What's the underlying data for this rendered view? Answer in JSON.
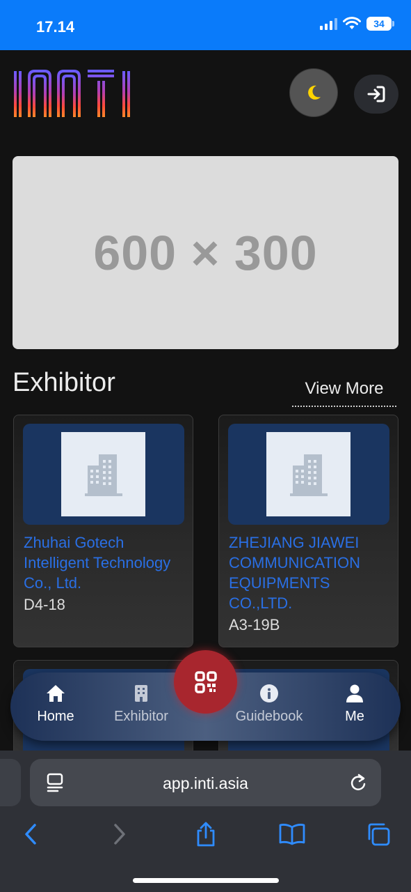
{
  "status_bar": {
    "time": "17.14",
    "battery": "34"
  },
  "header": {
    "logo_text": "INTI",
    "theme_icon": "moon-icon",
    "login_icon": "login-icon"
  },
  "banner": {
    "placeholder_text": "600 × 300"
  },
  "exhibitor_section": {
    "title": "Exhibitor",
    "view_more": "View More",
    "cards": [
      {
        "name": "Zhuhai Gotech Intelligent Technology Co., Ltd.",
        "booth": "D4-18",
        "icon": "building-icon"
      },
      {
        "name": "ZHEJIANG JIAWEI COMMUNICATION EQUIPMENTS CO.,LTD.",
        "booth": "A3-19B",
        "icon": "building-icon"
      }
    ]
  },
  "bottom_nav": {
    "items": [
      {
        "label": "Home",
        "icon": "home-icon",
        "active": true
      },
      {
        "label": "Exhibitor",
        "icon": "building-icon",
        "active": false
      },
      {
        "label": "Guidebook",
        "icon": "info-icon",
        "active": false
      },
      {
        "label": "Me",
        "icon": "user-icon",
        "active": false
      }
    ],
    "qr_icon": "qr-code-icon"
  },
  "browser": {
    "url": "app.inti.asia",
    "toolbar_icons": [
      "back-icon",
      "forward-icon",
      "share-icon",
      "bookmarks-icon",
      "tabs-icon"
    ]
  },
  "colors": {
    "status_bar": "#0a7bfa",
    "accent_link": "#2a6fe4",
    "qr_button": "#a8262e",
    "background": "#121212"
  }
}
